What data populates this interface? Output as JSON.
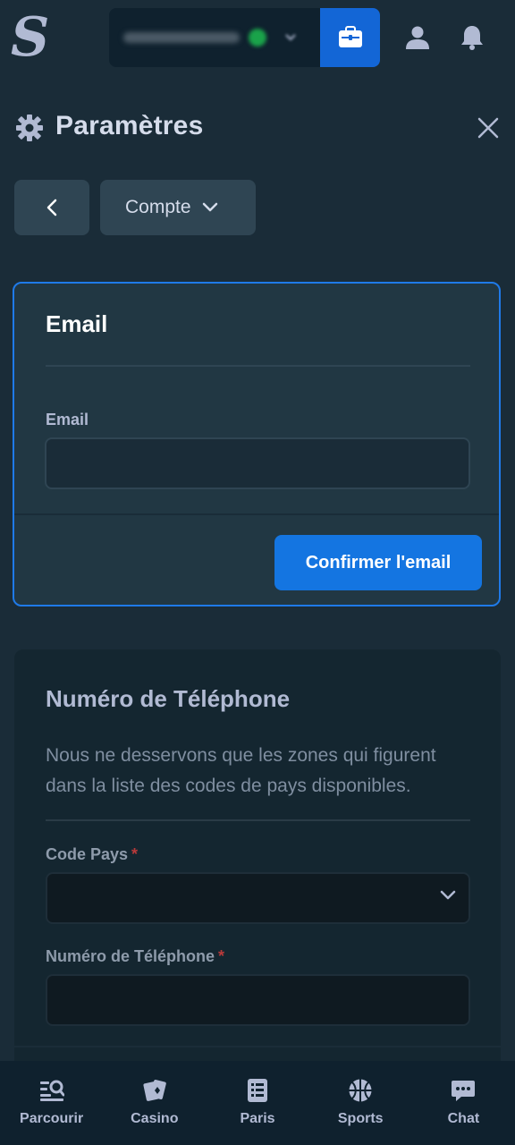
{
  "header": {
    "logo_text": "S",
    "icons": [
      "wallet-icon",
      "user-icon",
      "bell-icon"
    ],
    "accent_color": "#1475e1"
  },
  "settings": {
    "title": "Paramètres",
    "section_select": "Compte"
  },
  "email_card": {
    "title": "Email",
    "field_label": "Email",
    "email_value": "",
    "confirm_button": "Confirmer l'email"
  },
  "phone_card": {
    "title": "Numéro de Téléphone",
    "description": "Nous ne desservons que les zones qui figurent dans la liste des codes de pays disponibles.",
    "country_code_label": "Code Pays",
    "country_code_value": "",
    "phone_label": "Numéro de Téléphone",
    "phone_value": "",
    "required_mark": "*"
  },
  "bottom_nav": {
    "items": [
      {
        "label": "Parcourir",
        "icon": "browse-icon"
      },
      {
        "label": "Casino",
        "icon": "cards-icon"
      },
      {
        "label": "Paris",
        "icon": "betslip-icon"
      },
      {
        "label": "Sports",
        "icon": "basketball-icon"
      },
      {
        "label": "Chat",
        "icon": "chat-icon"
      }
    ]
  }
}
